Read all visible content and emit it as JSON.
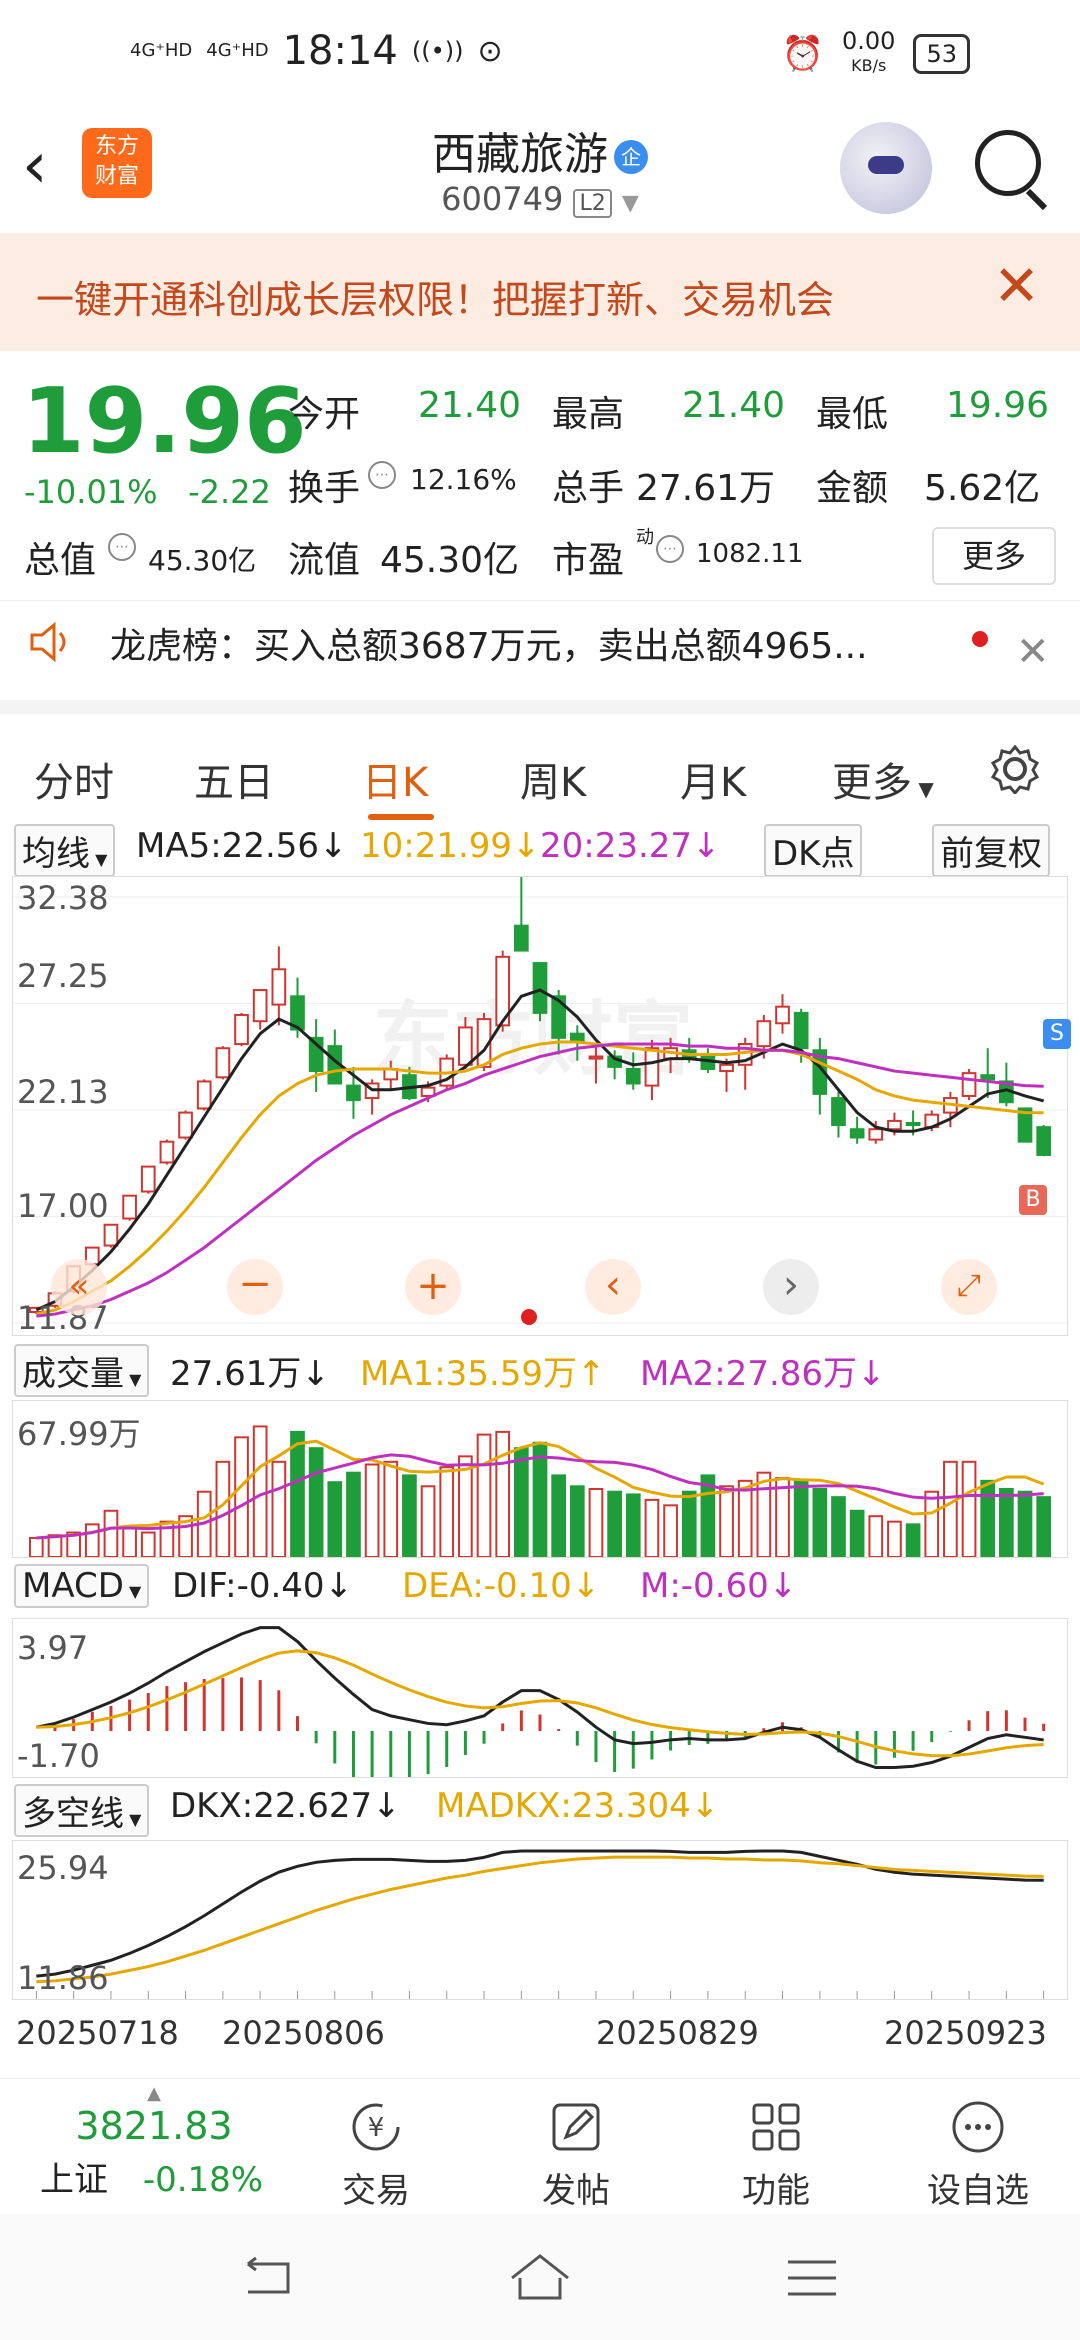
{
  "status": {
    "sig1": "4G⁺HD",
    "sig2": "4G⁺HD",
    "time": "18:14",
    "speed": "0.00",
    "speed_unit": "KB/s",
    "battery": "53"
  },
  "header": {
    "logo_line1": "东方",
    "logo_line2": "财富",
    "name": "西藏旅游",
    "badge": "企",
    "code": "600749",
    "level": "L2"
  },
  "banner": {
    "text": "一键开通科创成长层权限！把握打新、交易机会"
  },
  "quote": {
    "price": "19.96",
    "pct": "-10.01%",
    "chg": "-2.22",
    "open_label": "今开",
    "open": "21.40",
    "high_label": "最高",
    "high": "21.40",
    "low_label": "最低",
    "low": "19.96",
    "turnover_label": "换手",
    "turnover": "12.16%",
    "volume_label": "总手",
    "volume": "27.61万",
    "amount_label": "金额",
    "amount": "5.62亿",
    "mktcap_label": "总值",
    "mktcap": "45.30亿",
    "float_label": "流值",
    "float": "45.30亿",
    "pe_label": "市盈",
    "pe_sup": "动",
    "pe": "1082.11",
    "more": "更多"
  },
  "news": {
    "text": "龙虎榜：买入总额3687万元，卖出总额4965..."
  },
  "tabs": [
    "分时",
    "五日",
    "日K",
    "周K",
    "月K",
    "更多"
  ],
  "ma_bar": {
    "select": "均线",
    "ma5": "MA5:22.56↓",
    "ma10": "10:21.99↓",
    "ma20": "20:23.27↓",
    "dk": "DK点",
    "fq": "前复权"
  },
  "kline_axis": [
    "32.38",
    "27.25",
    "22.13",
    "17.00",
    "11.87"
  ],
  "markers": {
    "s": "S",
    "b": "B"
  },
  "vol_bar": {
    "select": "成交量",
    "v": "27.61万↓",
    "ma1": "MA1:35.59万↑",
    "ma2": "MA2:27.86万↓",
    "axis": "67.99万"
  },
  "macd_bar": {
    "select": "MACD",
    "dif": "DIF:-0.40↓",
    "dea": "DEA:-0.10↓",
    "m": "M:-0.60↓",
    "axis_top": "3.97",
    "axis_bot": "-1.70"
  },
  "dkx_bar": {
    "select": "多空线",
    "dkx": "DKX:22.627↓",
    "madkx": "MADKX:23.304↓",
    "axis_top": "25.94",
    "axis_bot": "11.86"
  },
  "dates": [
    "20250718",
    "20250806",
    "20250829",
    "20250923"
  ],
  "bottom": {
    "index_value": "3821.83",
    "index_name": "上证",
    "index_pct": "-0.18%",
    "items": [
      "交易",
      "发帖",
      "功能",
      "设自选"
    ]
  },
  "colors": {
    "up": "#d0352f",
    "down": "#1f9d3a",
    "ma5": "#222222",
    "ma10": "#e6a800",
    "ma20": "#c030c0"
  },
  "chart_data": {
    "type": "candlestick",
    "price_axis": [
      32.38,
      27.25,
      22.13,
      17.0,
      11.87
    ],
    "candles": [
      [
        12.4,
        12.6,
        12.3,
        12.6
      ],
      [
        12.7,
        13.4,
        12.6,
        13.3
      ],
      [
        13.4,
        14.6,
        13.3,
        14.6
      ],
      [
        14.7,
        15.5,
        14.6,
        15.5
      ],
      [
        15.6,
        16.6,
        15.5,
        16.6
      ],
      [
        16.9,
        18.0,
        16.8,
        18.0
      ],
      [
        18.2,
        19.4,
        18.1,
        19.4
      ],
      [
        19.6,
        20.7,
        19.5,
        20.6
      ],
      [
        20.8,
        22.1,
        20.7,
        22.0
      ],
      [
        22.2,
        23.6,
        22.1,
        23.5
      ],
      [
        23.7,
        25.2,
        23.6,
        25.1
      ],
      [
        25.3,
        26.8,
        25.2,
        26.7
      ],
      [
        26.4,
        27.9,
        26.0,
        27.9
      ],
      [
        27.2,
        30.0,
        26.2,
        28.9
      ],
      [
        27.6,
        28.5,
        25.6,
        26.0
      ],
      [
        25.6,
        26.5,
        23.0,
        24.0
      ],
      [
        25.2,
        26.0,
        23.4,
        23.4
      ],
      [
        23.3,
        24.2,
        21.7,
        22.6
      ],
      [
        22.7,
        23.6,
        21.9,
        23.4
      ],
      [
        23.6,
        24.5,
        23.1,
        24.1
      ],
      [
        23.8,
        24.2,
        22.6,
        22.7
      ],
      [
        22.8,
        23.5,
        22.5,
        23.2
      ],
      [
        23.3,
        24.8,
        23.1,
        24.6
      ],
      [
        24.3,
        26.6,
        24.1,
        26.1
      ],
      [
        24.2,
        26.8,
        24.0,
        26.5
      ],
      [
        26.2,
        29.8,
        25.9,
        29.5
      ],
      [
        31.0,
        33.9,
        29.8,
        29.8
      ],
      [
        29.2,
        28.9,
        26.4,
        26.8
      ],
      [
        27.6,
        27.9,
        24.8,
        25.6
      ],
      [
        25.8,
        26.2,
        24.5,
        25.4
      ],
      [
        24.6,
        25.2,
        23.4,
        24.7
      ],
      [
        24.7,
        25.0,
        23.6,
        24.2
      ],
      [
        24.1,
        24.9,
        23.1,
        23.4
      ],
      [
        23.3,
        25.5,
        22.6,
        25.1
      ],
      [
        24.6,
        25.6,
        23.9,
        25.1
      ],
      [
        25.0,
        25.6,
        24.4,
        24.6
      ],
      [
        24.7,
        25.1,
        23.9,
        24.1
      ],
      [
        24.0,
        24.6,
        23.0,
        24.3
      ],
      [
        24.3,
        25.6,
        23.1,
        25.3
      ],
      [
        25.2,
        26.7,
        24.6,
        26.4
      ],
      [
        26.3,
        27.7,
        25.8,
        27.1
      ],
      [
        26.8,
        27.0,
        24.4,
        25.1
      ],
      [
        25.0,
        25.6,
        21.9,
        22.9
      ],
      [
        22.7,
        23.1,
        20.8,
        21.4
      ],
      [
        21.2,
        21.8,
        20.5,
        20.8
      ],
      [
        20.7,
        21.6,
        20.5,
        21.2
      ],
      [
        21.2,
        22.0,
        20.9,
        21.6
      ],
      [
        21.5,
        22.1,
        20.9,
        21.4
      ],
      [
        21.3,
        22.1,
        21.1,
        21.9
      ],
      [
        22.0,
        23.0,
        21.3,
        22.7
      ],
      [
        22.8,
        24.1,
        22.6,
        23.9
      ],
      [
        23.8,
        25.1,
        22.7,
        23.6
      ],
      [
        23.5,
        24.4,
        22.3,
        22.5
      ],
      [
        22.2,
        21.4,
        20.8,
        20.6
      ],
      [
        21.3,
        21.4,
        19.9,
        19.96
      ]
    ],
    "ma_series": [
      {
        "name": "MA5",
        "values": [
          12.5,
          12.9,
          13.6,
          14.4,
          15.3,
          16.4,
          17.6,
          19.0,
          20.4,
          21.8,
          23.2,
          24.6,
          25.8,
          26.5,
          26.1,
          25.3,
          24.5,
          23.8,
          23.1,
          23.1,
          23.2,
          23.3,
          23.6,
          24.2,
          25.0,
          26.4,
          27.6,
          27.9,
          27.4,
          26.6,
          25.5,
          24.6,
          24.3,
          24.4,
          24.6,
          24.6,
          24.5,
          24.4,
          24.5,
          24.9,
          25.3,
          25.0,
          24.2,
          23.1,
          22.0,
          21.3,
          21.1,
          21.1,
          21.3,
          21.7,
          22.3,
          22.9,
          23.1,
          22.8,
          22.56
        ]
      },
      {
        "name": "MA10",
        "values": [
          12.3,
          12.5,
          12.9,
          13.4,
          13.9,
          14.6,
          15.4,
          16.3,
          17.3,
          18.4,
          19.6,
          20.8,
          21.9,
          22.8,
          23.4,
          23.8,
          24.0,
          24.1,
          24.1,
          24.1,
          24.0,
          23.9,
          23.9,
          24.0,
          24.3,
          24.8,
          25.1,
          25.3,
          25.4,
          25.4,
          25.3,
          25.2,
          25.1,
          25.0,
          24.9,
          24.8,
          24.8,
          24.8,
          24.9,
          25.0,
          25.0,
          24.8,
          24.4,
          24.0,
          23.6,
          23.1,
          22.8,
          22.6,
          22.5,
          22.4,
          22.3,
          22.2,
          22.1,
          22.0,
          21.99
        ]
      },
      {
        "name": "MA20",
        "values": [
          12.2,
          12.3,
          12.5,
          12.7,
          13.0,
          13.4,
          13.8,
          14.3,
          14.9,
          15.5,
          16.2,
          16.9,
          17.6,
          18.3,
          19.0,
          19.7,
          20.3,
          20.9,
          21.4,
          21.9,
          22.3,
          22.7,
          23.1,
          23.4,
          23.8,
          24.1,
          24.4,
          24.7,
          24.9,
          25.1,
          25.2,
          25.3,
          25.3,
          25.3,
          25.3,
          25.2,
          25.2,
          25.1,
          25.1,
          25.0,
          25.0,
          24.9,
          24.7,
          24.6,
          24.4,
          24.2,
          24.0,
          23.9,
          23.8,
          23.7,
          23.6,
          23.5,
          23.4,
          23.3,
          23.27
        ]
      }
    ]
  }
}
